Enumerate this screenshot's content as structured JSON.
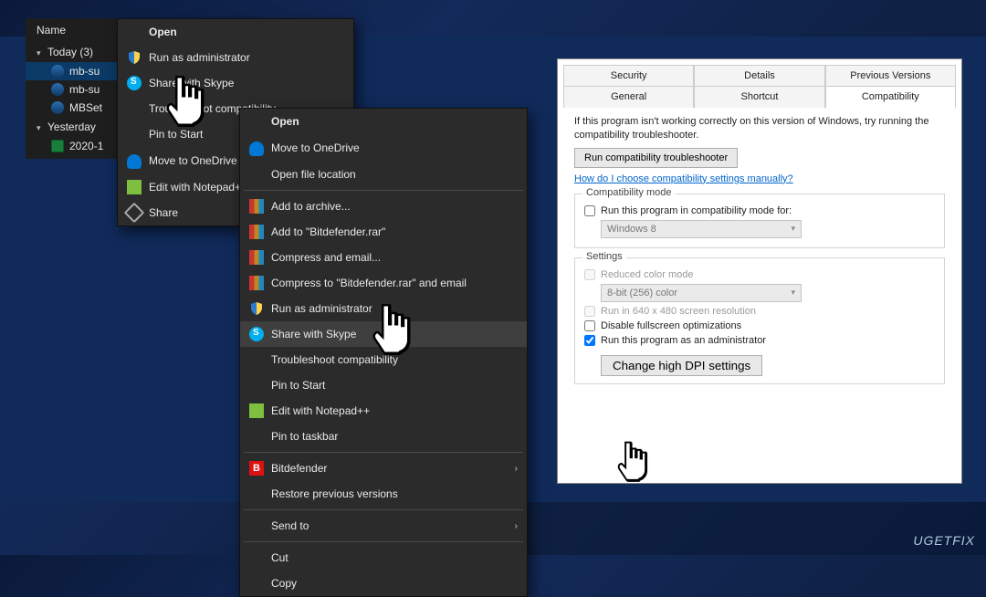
{
  "watermark": "UGETFIX",
  "explorer": {
    "header": "Name",
    "groups": [
      {
        "label": "Today (3)",
        "files": [
          {
            "name": "mb-su",
            "icon": "mb",
            "selected": true
          },
          {
            "name": "mb-su",
            "icon": "mb"
          },
          {
            "name": "MBSet",
            "icon": "mb"
          }
        ]
      },
      {
        "label": "Yesterday",
        "files": [
          {
            "name": "2020-1",
            "icon": "xlsx"
          }
        ]
      }
    ]
  },
  "menu1": {
    "header": "Open",
    "items": [
      {
        "icon": "shield",
        "label": "Run as administrator"
      },
      {
        "icon": "skype",
        "label": "Share with Skype"
      },
      {
        "icon": "",
        "label": "Troubleshoot compatibility"
      },
      {
        "icon": "",
        "label": "Pin to Start"
      },
      {
        "icon": "cloud",
        "label": "Move to OneDrive"
      },
      {
        "icon": "np",
        "label": "Edit with Notepad++"
      },
      {
        "icon": "share",
        "label": "Share"
      }
    ]
  },
  "menu2": {
    "header": "Open",
    "items": [
      {
        "icon": "cloud",
        "label": "Move to OneDrive"
      },
      {
        "icon": "",
        "label": "Open file location"
      },
      {
        "type": "sep"
      },
      {
        "icon": "books",
        "label": "Add to archive..."
      },
      {
        "icon": "books",
        "label": "Add to \"Bitdefender.rar\""
      },
      {
        "icon": "books",
        "label": "Compress and email..."
      },
      {
        "icon": "books",
        "label": "Compress to \"Bitdefender.rar\" and email"
      },
      {
        "icon": "shield",
        "label": "Run as administrator"
      },
      {
        "icon": "skype",
        "label": "Share with Skype",
        "selected": true
      },
      {
        "icon": "",
        "label": "Troubleshoot compatibility"
      },
      {
        "icon": "",
        "label": "Pin to Start"
      },
      {
        "icon": "np",
        "label": "Edit with Notepad++"
      },
      {
        "icon": "",
        "label": "Pin to taskbar"
      },
      {
        "type": "sep"
      },
      {
        "icon": "bd",
        "label": "Bitdefender",
        "sub": true,
        "bdText": "B"
      },
      {
        "icon": "",
        "label": "Restore previous versions"
      },
      {
        "type": "sep"
      },
      {
        "icon": "",
        "label": "Send to",
        "sub": true
      },
      {
        "type": "sep"
      },
      {
        "icon": "",
        "label": "Cut"
      },
      {
        "icon": "",
        "label": "Copy"
      }
    ]
  },
  "props": {
    "tabs_row1": [
      "Security",
      "Details",
      "Previous Versions"
    ],
    "tabs_row2": [
      "General",
      "Shortcut",
      "Compatibility"
    ],
    "active_tab": "Compatibility",
    "hint": "If this program isn't working correctly on this version of Windows, try running the compatibility troubleshooter.",
    "run_trouble": "Run compatibility troubleshooter",
    "link": "How do I choose compatibility settings manually?",
    "compat_legend": "Compatibility mode",
    "compat_check": "Run this program in compatibility mode for:",
    "compat_combo": "Windows 8",
    "settings_legend": "Settings",
    "reduced_color": "Reduced color mode",
    "color_combo": "8-bit (256) color",
    "run640": "Run in 640 x 480 screen resolution",
    "disable_fs": "Disable fullscreen optimizations",
    "run_admin": "Run this program as an administrator",
    "dpi": "Change high DPI settings"
  }
}
